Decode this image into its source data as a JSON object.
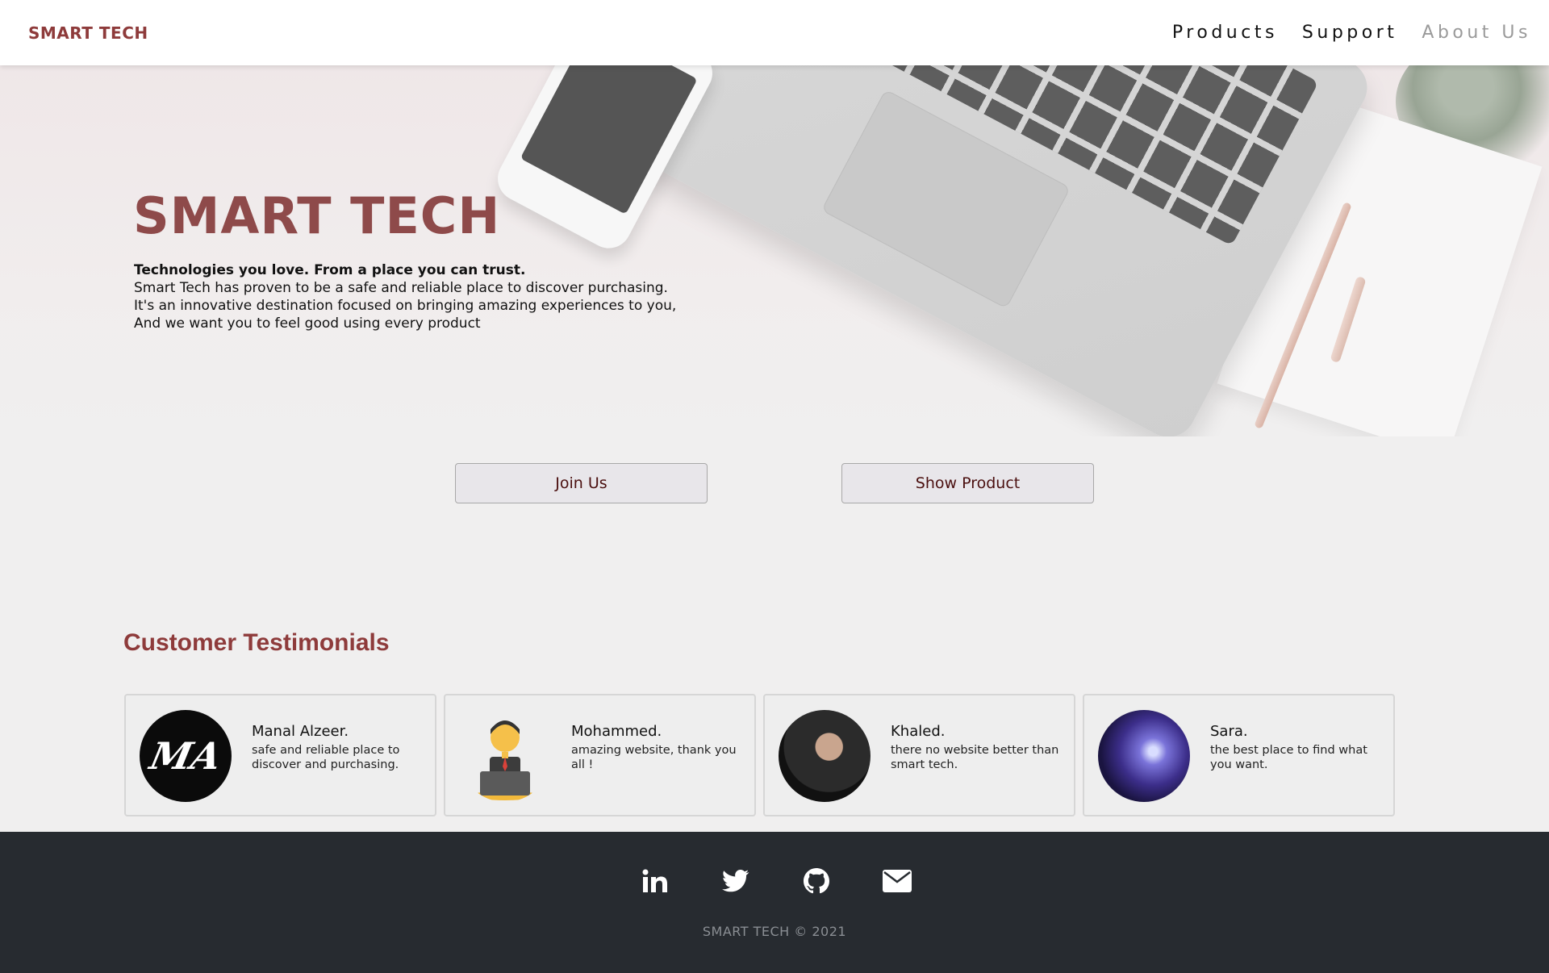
{
  "nav": {
    "brand": "SMART TECH",
    "links": [
      "Products",
      "Support",
      "About Us"
    ]
  },
  "hero": {
    "title": "SMART TECH",
    "lead": "Technologies you love. From a place you can trust.",
    "lines": [
      "Smart Tech has proven to be a safe and reliable place to discover purchasing.",
      "It's an innovative destination focused on bringing amazing experiences to you,",
      "And we want you to feel good using every product"
    ]
  },
  "buttons": {
    "join": "Join Us",
    "show": "Show Product"
  },
  "testimonials": {
    "title": "Customer Testimonials",
    "items": [
      {
        "name": "Manal Alzeer.",
        "text": "safe and reliable place to discover and purchasing.",
        "avatar_text": "MA"
      },
      {
        "name": "Mohammed.",
        "text": "amazing website, thank you all !"
      },
      {
        "name": "Khaled.",
        "text": "there no website better than smart tech."
      },
      {
        "name": "Sara.",
        "text": "the best place to find what you want."
      }
    ]
  },
  "footer": {
    "icons": [
      "linkedin-icon",
      "twitter-icon",
      "github-icon",
      "envelope-icon"
    ],
    "copyright": "SMART TECH © 2021"
  },
  "colors": {
    "brand": "#8e3b3b",
    "footer_bg": "#272b30"
  }
}
